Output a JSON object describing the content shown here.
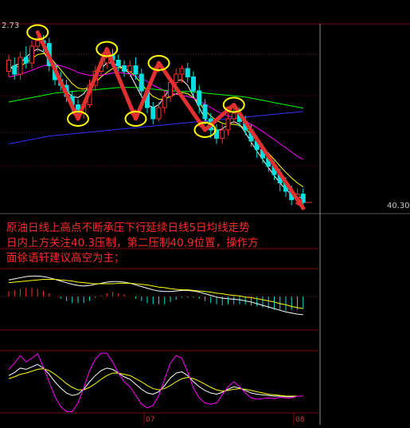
{
  "chart_data": {
    "type": "candlestick",
    "high_label": "2.73",
    "last_price_label": "40.30",
    "annotation": [
      "原油日线上高点不断承压下行延续日线5日均线走势",
      "日内上方关注40.3压制，第二压制40.9位置，操作方",
      "面徐语轩建议高空为主；"
    ],
    "month_labels": [
      "07",
      "08"
    ],
    "y_range": [
      39.6,
      43.0
    ],
    "candles": [
      [
        42.15,
        42.35,
        42.05,
        42.45
      ],
      [
        42.25,
        42.1,
        42.0,
        42.4
      ],
      [
        42.1,
        42.4,
        42.0,
        42.5
      ],
      [
        42.4,
        42.3,
        42.2,
        42.6
      ],
      [
        42.3,
        42.6,
        42.2,
        42.7
      ],
      [
        42.6,
        42.7,
        42.5,
        42.85
      ],
      [
        42.7,
        42.65,
        42.5,
        42.8
      ],
      [
        42.65,
        42.25,
        42.15,
        42.75
      ],
      [
        42.25,
        42.0,
        41.9,
        42.3
      ],
      [
        42.0,
        41.9,
        41.8,
        42.15
      ],
      [
        41.9,
        41.7,
        41.6,
        42.0
      ],
      [
        41.7,
        41.55,
        41.4,
        41.8
      ],
      [
        41.55,
        41.4,
        41.3,
        41.65
      ],
      [
        41.4,
        41.55,
        41.3,
        41.65
      ],
      [
        41.55,
        41.9,
        41.5,
        42.0
      ],
      [
        41.9,
        42.15,
        41.8,
        42.25
      ],
      [
        42.15,
        42.3,
        42.05,
        42.4
      ],
      [
        42.3,
        42.45,
        42.2,
        42.55
      ],
      [
        42.45,
        42.35,
        42.25,
        42.55
      ],
      [
        42.35,
        42.25,
        42.15,
        42.45
      ],
      [
        42.25,
        42.15,
        42.05,
        42.35
      ],
      [
        42.15,
        42.25,
        42.05,
        42.35
      ],
      [
        42.25,
        42.1,
        42.0,
        42.4
      ],
      [
        42.1,
        41.8,
        41.7,
        42.2
      ],
      [
        41.8,
        41.5,
        41.4,
        41.85
      ],
      [
        41.5,
        41.3,
        41.2,
        41.6
      ],
      [
        41.3,
        41.5,
        41.25,
        41.6
      ],
      [
        41.5,
        41.7,
        41.4,
        41.8
      ],
      [
        41.7,
        41.95,
        41.6,
        42.05
      ],
      [
        41.95,
        42.1,
        41.85,
        42.2
      ],
      [
        42.1,
        42.2,
        41.95,
        42.25
      ],
      [
        42.2,
        42.05,
        41.95,
        42.3
      ],
      [
        42.05,
        41.8,
        41.7,
        42.15
      ],
      [
        41.8,
        41.55,
        41.4,
        41.9
      ],
      [
        41.55,
        41.3,
        41.2,
        41.65
      ],
      [
        41.3,
        41.1,
        40.95,
        41.4
      ],
      [
        41.1,
        40.95,
        40.85,
        41.2
      ],
      [
        40.95,
        41.1,
        40.85,
        41.2
      ],
      [
        41.1,
        41.3,
        41.0,
        41.4
      ],
      [
        41.3,
        41.4,
        41.2,
        41.5
      ],
      [
        41.4,
        41.25,
        41.15,
        41.5
      ],
      [
        41.25,
        41.1,
        41.0,
        41.35
      ],
      [
        41.1,
        40.9,
        40.8,
        41.2
      ],
      [
        40.9,
        40.75,
        40.6,
        41.0
      ],
      [
        40.75,
        40.6,
        40.5,
        40.85
      ],
      [
        40.6,
        40.45,
        40.35,
        40.7
      ],
      [
        40.45,
        40.3,
        40.2,
        40.55
      ],
      [
        40.3,
        40.15,
        40.0,
        40.4
      ],
      [
        40.15,
        40.0,
        39.9,
        40.25
      ],
      [
        40.0,
        39.85,
        39.75,
        40.1
      ],
      [
        39.85,
        39.95,
        39.75,
        40.05
      ],
      [
        39.95,
        39.8,
        39.7,
        40.05
      ]
    ],
    "ma_series": [
      {
        "color": "#ffffff",
        "values": [
          42.2,
          42.25,
          42.3,
          42.4,
          42.5,
          42.55,
          42.5,
          42.35,
          42.15,
          41.95,
          41.8,
          41.7,
          41.68,
          41.75,
          41.9,
          42.05,
          42.2,
          42.3,
          42.3,
          42.25,
          42.2,
          42.1,
          41.9,
          41.7,
          41.55,
          41.5,
          41.55,
          41.7,
          41.85,
          41.98,
          42.0,
          41.9,
          41.7,
          41.5,
          41.3,
          41.15,
          41.08,
          41.12,
          41.2,
          41.25,
          41.2,
          41.05,
          40.88,
          40.72,
          40.57,
          40.42,
          40.28,
          40.15,
          40.03,
          39.95,
          39.9,
          39.88
        ]
      },
      {
        "color": "#ffff00",
        "values": [
          42.2,
          42.22,
          42.25,
          42.3,
          42.38,
          42.45,
          42.47,
          42.42,
          42.3,
          42.18,
          42.05,
          41.93,
          41.85,
          41.83,
          41.87,
          41.95,
          42.05,
          42.13,
          42.2,
          42.22,
          42.2,
          42.15,
          42.05,
          41.93,
          41.8,
          41.7,
          41.65,
          41.65,
          41.7,
          41.75,
          41.77,
          41.75,
          41.68,
          41.58,
          41.45,
          41.35,
          41.27,
          41.22,
          41.2,
          41.2,
          41.18,
          41.12,
          41.02,
          40.92,
          40.8,
          40.68,
          40.57,
          40.45,
          40.34,
          40.24,
          40.15,
          40.08
        ]
      },
      {
        "color": "#ff00ff",
        "values": [
          42.05,
          42.07,
          42.1,
          42.13,
          42.17,
          42.21,
          42.25,
          42.27,
          42.27,
          42.25,
          42.22,
          42.18,
          42.13,
          42.1,
          42.08,
          42.07,
          42.08,
          42.1,
          42.12,
          42.13,
          42.12,
          42.1,
          42.07,
          42.02,
          41.97,
          41.9,
          41.85,
          41.8,
          41.76,
          41.74,
          41.72,
          41.7,
          41.67,
          41.62,
          41.56,
          41.5,
          41.44,
          41.39,
          41.35,
          41.32,
          41.29,
          41.25,
          41.2,
          41.14,
          41.07,
          41.0,
          40.93,
          40.85,
          40.78,
          40.7,
          40.63,
          40.57
        ]
      },
      {
        "color": "#00ff00",
        "values": [
          41.6,
          41.62,
          41.64,
          41.66,
          41.68,
          41.7,
          41.72,
          41.74,
          41.76,
          41.77,
          41.78,
          41.79,
          41.8,
          41.8,
          41.81,
          41.82,
          41.83,
          41.84,
          41.85,
          41.86,
          41.86,
          41.86,
          41.86,
          41.85,
          41.84,
          41.83,
          41.82,
          41.81,
          41.8,
          41.8,
          41.79,
          41.79,
          41.78,
          41.77,
          41.76,
          41.75,
          41.74,
          41.73,
          41.72,
          41.71,
          41.7,
          41.69,
          41.67,
          41.65,
          41.63,
          41.61,
          41.59,
          41.57,
          41.55,
          41.53,
          41.51,
          41.49
        ]
      },
      {
        "color": "#3030ff",
        "values": [
          40.85,
          40.87,
          40.89,
          40.91,
          40.93,
          40.95,
          40.97,
          40.99,
          41.0,
          41.01,
          41.02,
          41.03,
          41.04,
          41.05,
          41.06,
          41.07,
          41.08,
          41.09,
          41.1,
          41.11,
          41.12,
          41.13,
          41.14,
          41.15,
          41.16,
          41.17,
          41.18,
          41.19,
          41.2,
          41.21,
          41.22,
          41.23,
          41.24,
          41.25,
          41.26,
          41.27,
          41.28,
          41.29,
          41.3,
          41.31,
          41.32,
          41.33,
          41.34,
          41.35,
          41.36,
          41.37,
          41.38,
          41.39,
          41.4,
          41.41,
          41.42,
          41.43
        ]
      }
    ],
    "swing_markers": [
      {
        "index": 5,
        "price": 42.85
      },
      {
        "index": 12,
        "price": 41.3
      },
      {
        "index": 17,
        "price": 42.55
      },
      {
        "index": 22,
        "price": 41.3
      },
      {
        "index": 26,
        "price": 42.3
      },
      {
        "index": 34,
        "price": 41.1
      },
      {
        "index": 39,
        "price": 41.55
      }
    ],
    "macd": {
      "dif": [
        0.3,
        0.32,
        0.34,
        0.36,
        0.37,
        0.37,
        0.36,
        0.34,
        0.31,
        0.28,
        0.25,
        0.22,
        0.2,
        0.19,
        0.2,
        0.22,
        0.24,
        0.26,
        0.27,
        0.27,
        0.26,
        0.24,
        0.21,
        0.18,
        0.15,
        0.12,
        0.1,
        0.09,
        0.09,
        0.1,
        0.11,
        0.11,
        0.1,
        0.08,
        0.05,
        0.02,
        -0.01,
        -0.03,
        -0.04,
        -0.05,
        -0.06,
        -0.08,
        -0.1,
        -0.13,
        -0.16,
        -0.19,
        -0.22,
        -0.25,
        -0.28,
        -0.3,
        -0.32,
        -0.33
      ],
      "dea": [
        0.25,
        0.26,
        0.27,
        0.28,
        0.29,
        0.3,
        0.31,
        0.31,
        0.31,
        0.3,
        0.29,
        0.28,
        0.26,
        0.25,
        0.24,
        0.23,
        0.23,
        0.23,
        0.23,
        0.24,
        0.24,
        0.24,
        0.23,
        0.22,
        0.21,
        0.19,
        0.17,
        0.16,
        0.14,
        0.13,
        0.12,
        0.12,
        0.11,
        0.1,
        0.09,
        0.08,
        0.06,
        0.05,
        0.03,
        0.02,
        0.01,
        -0.01,
        -0.02,
        -0.04,
        -0.06,
        -0.08,
        -0.1,
        -0.13,
        -0.15,
        -0.18,
        -0.2,
        -0.22
      ],
      "hist": [
        0.1,
        0.12,
        0.14,
        0.16,
        0.16,
        0.14,
        0.1,
        0.06,
        0.0,
        -0.04,
        -0.08,
        -0.12,
        -0.12,
        -0.12,
        -0.08,
        -0.02,
        0.02,
        0.06,
        0.08,
        0.06,
        0.04,
        0.0,
        -0.04,
        -0.08,
        -0.12,
        -0.14,
        -0.14,
        -0.14,
        -0.1,
        -0.06,
        -0.02,
        -0.02,
        -0.02,
        -0.04,
        -0.08,
        -0.12,
        -0.14,
        -0.16,
        -0.14,
        -0.14,
        -0.14,
        -0.14,
        -0.16,
        -0.18,
        -0.2,
        -0.22,
        -0.24,
        -0.24,
        -0.26,
        -0.24,
        -0.24,
        -0.22
      ]
    },
    "kdj": {
      "k": [
        60,
        65,
        72,
        70,
        74,
        78,
        72,
        62,
        50,
        40,
        32,
        28,
        30,
        38,
        50,
        60,
        68,
        72,
        70,
        64,
        58,
        54,
        46,
        38,
        32,
        30,
        34,
        44,
        56,
        64,
        66,
        60,
        50,
        42,
        36,
        32,
        30,
        33,
        38,
        42,
        40,
        36,
        32,
        30,
        29,
        28,
        27,
        27,
        26,
        26,
        27,
        27
      ],
      "d": [
        55,
        58,
        62,
        64,
        67,
        70,
        71,
        68,
        62,
        55,
        47,
        41,
        37,
        37,
        41,
        47,
        54,
        60,
        64,
        64,
        62,
        60,
        55,
        50,
        44,
        39,
        37,
        39,
        44,
        50,
        55,
        57,
        55,
        51,
        46,
        41,
        37,
        35,
        36,
        38,
        39,
        38,
        36,
        34,
        32,
        30,
        29,
        28,
        27,
        27,
        27,
        27
      ],
      "j": [
        70,
        80,
        92,
        82,
        88,
        95,
        74,
        50,
        26,
        10,
        2,
        2,
        16,
        40,
        68,
        86,
        96,
        96,
        82,
        64,
        50,
        42,
        28,
        14,
        8,
        12,
        28,
        54,
        80,
        92,
        88,
        66,
        40,
        24,
        16,
        14,
        16,
        29,
        42,
        50,
        42,
        32,
        24,
        22,
        23,
        24,
        23,
        25,
        24,
        24,
        27,
        27
      ]
    }
  }
}
